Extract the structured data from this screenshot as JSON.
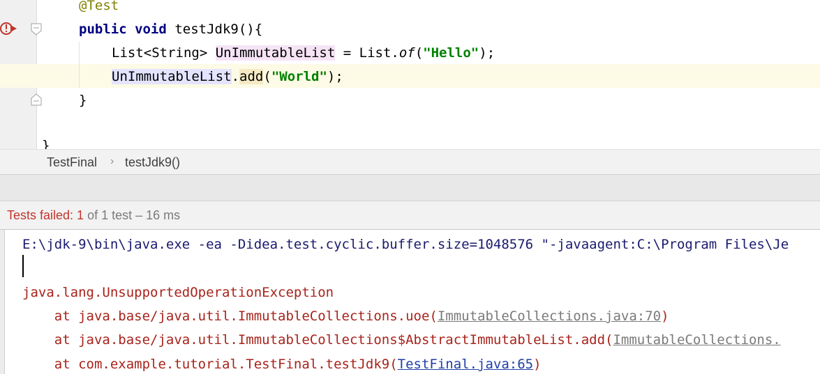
{
  "editor": {
    "annotation": "@Test",
    "kw_public": "public",
    "kw_void": "void",
    "method_name": "testJdk9",
    "method_parens": "(){",
    "line2_type": "List<String> ",
    "line2_var": "UnImmutableList",
    "line2_assign": " = List.",
    "line2_of": "of",
    "line2_open": "(",
    "line2_str": "\"Hello\"",
    "line2_close": ");",
    "line3_var": "UnImmutableList",
    "line3_dot": ".",
    "line3_add": "add",
    "line3_open": "(",
    "line3_str": "\"World\"",
    "line3_close": ");",
    "close_brace": "}",
    "class_brace": "}"
  },
  "breadcrumb": {
    "items": [
      "TestFinal",
      "testJdk9()"
    ],
    "separator": "›"
  },
  "status": {
    "failed_label": "Tests failed: 1",
    "rest": "of 1 test – 16 ms"
  },
  "console": {
    "command": "E:\\jdk-9\\bin\\java.exe -ea -Didea.test.cyclic.buffer.size=1048576 \"-javaagent:C:\\Program Files\\Je",
    "exception": "java.lang.UnsupportedOperationException",
    "frames": [
      {
        "text": "    at java.base/java.util.ImmutableCollections.uoe(",
        "link": "ImmutableCollections.java:70",
        "tail": ")"
      },
      {
        "text": "    at java.base/java.util.ImmutableCollections$AbstractImmutableList.add(",
        "link": "ImmutableCollections.",
        "tail": ""
      },
      {
        "text": "    at com.example.tutorial.TestFinal.testJdk9(",
        "link": "TestFinal.java:65",
        "tail": ")"
      }
    ]
  },
  "colors": {
    "failed": "#c0352b",
    "keyword": "#000080",
    "string": "#008000",
    "annotation": "#808000",
    "exception": "#a8231b"
  },
  "icons": {
    "run_error": "run-error-icon",
    "fold_start": "fold-start-icon",
    "fold_end": "fold-end-icon"
  }
}
